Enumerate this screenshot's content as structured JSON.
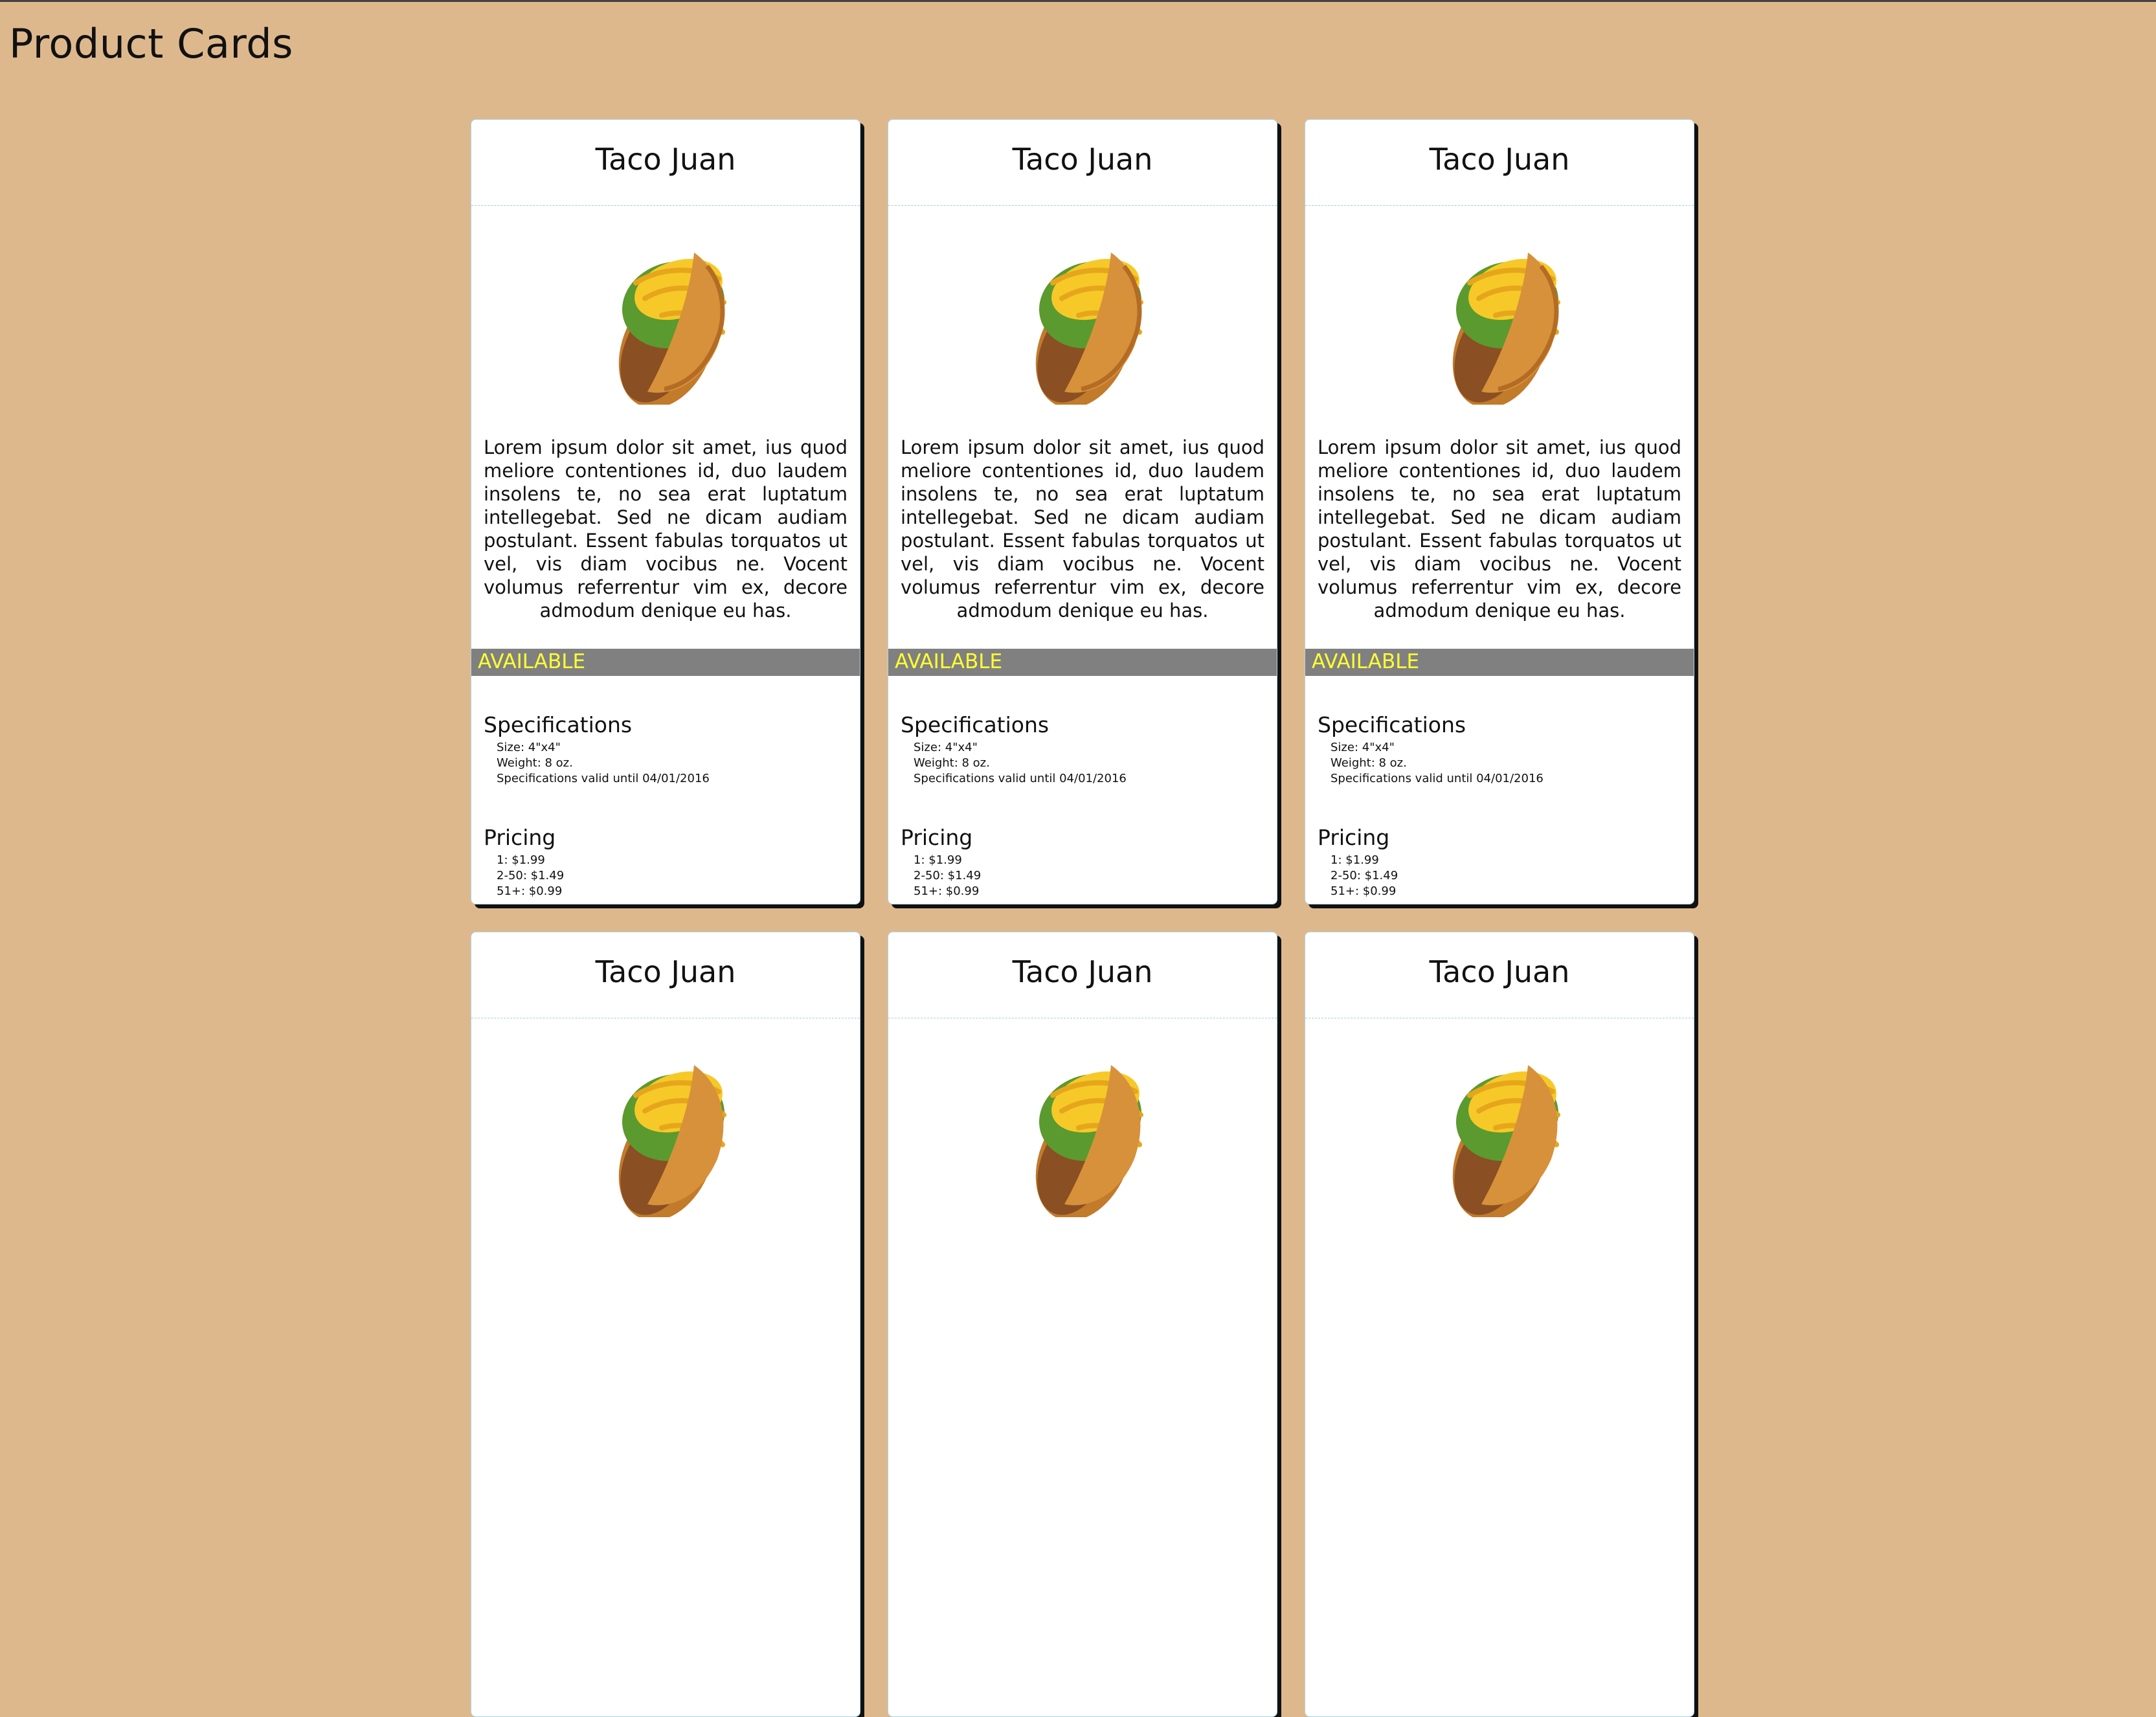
{
  "page": {
    "title": "Product Cards"
  },
  "colors": {
    "background": "#deb88d",
    "status_bar": "#808080",
    "status_text": "#ffff33",
    "card_border": "#a9d6e5"
  },
  "cards": [
    {
      "title": "Taco Juan",
      "image_icon": "taco-image",
      "description": "Lorem ipsum dolor sit amet, ius quod meliore contentiones id, duo laudem insolens te, no sea erat luptatum intellegebat. Sed ne dicam audiam postulant. Essent fabulas torquatos ut vel, vis diam vocibus ne. Vocent volumus referrentur vim ex, decore admodum denique eu has.",
      "status": "AVAILABLE",
      "specifications": {
        "heading": "Specifications",
        "items": [
          "Size: 4\"x4\"",
          "Weight: 8 oz.",
          "Specifications valid until 04/01/2016"
        ]
      },
      "pricing": {
        "heading": "Pricing",
        "items": [
          "1: $1.99",
          "2-50: $1.49",
          "51+: $0.99"
        ]
      }
    },
    {
      "title": "Taco Juan",
      "image_icon": "taco-image",
      "description": "Lorem ipsum dolor sit amet, ius quod meliore contentiones id, duo laudem insolens te, no sea erat luptatum intellegebat. Sed ne dicam audiam postulant. Essent fabulas torquatos ut vel, vis diam vocibus ne. Vocent volumus referrentur vim ex, decore admodum denique eu has.",
      "status": "AVAILABLE",
      "specifications": {
        "heading": "Specifications",
        "items": [
          "Size: 4\"x4\"",
          "Weight: 8 oz.",
          "Specifications valid until 04/01/2016"
        ]
      },
      "pricing": {
        "heading": "Pricing",
        "items": [
          "1: $1.99",
          "2-50: $1.49",
          "51+: $0.99"
        ]
      }
    },
    {
      "title": "Taco Juan",
      "image_icon": "taco-image",
      "description": "Lorem ipsum dolor sit amet, ius quod meliore contentiones id, duo laudem insolens te, no sea erat luptatum intellegebat. Sed ne dicam audiam postulant. Essent fabulas torquatos ut vel, vis diam vocibus ne. Vocent volumus referrentur vim ex, decore admodum denique eu has.",
      "status": "AVAILABLE",
      "specifications": {
        "heading": "Specifications",
        "items": [
          "Size: 4\"x4\"",
          "Weight: 8 oz.",
          "Specifications valid until 04/01/2016"
        ]
      },
      "pricing": {
        "heading": "Pricing",
        "items": [
          "1: $1.99",
          "2-50: $1.49",
          "51+: $0.99"
        ]
      }
    },
    {
      "title": "Taco Juan",
      "image_icon": "taco-image"
    },
    {
      "title": "Taco Juan",
      "image_icon": "taco-image"
    },
    {
      "title": "Taco Juan",
      "image_icon": "taco-image"
    }
  ]
}
